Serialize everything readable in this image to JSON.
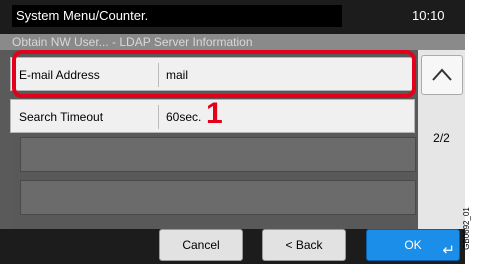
{
  "header": {
    "title": "System Menu/Counter.",
    "time": "10:10",
    "breadcrumb": "Obtain NW User... - LDAP Server Information"
  },
  "settings": [
    {
      "label": "E-mail Address",
      "value": "mail"
    },
    {
      "label": "Search Timeout",
      "value": "60sec."
    }
  ],
  "pagination": {
    "page": "2/2"
  },
  "footer": {
    "cancel": "Cancel",
    "back": "< Back",
    "ok": "OK",
    "enter_icon": "enter-icon"
  },
  "annotation": {
    "callout": "1"
  },
  "figure_code": "GB0692_01",
  "colors": {
    "highlight": "#e3001b",
    "ok_button": "#1a8ee8"
  }
}
